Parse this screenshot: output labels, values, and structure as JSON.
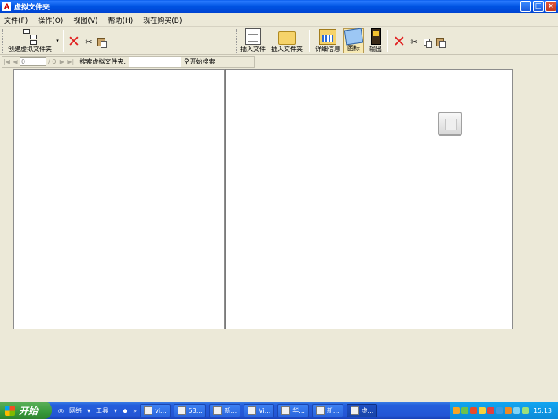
{
  "window": {
    "title": "虚拟文件夹",
    "min": "_",
    "max": "□",
    "close": "×"
  },
  "menu": [
    "文件(F)",
    "操作(O)",
    "视图(V)",
    "帮助(H)",
    "现在购买(B)"
  ],
  "toolbar": {
    "create_folder": "创建虚拟文件夹",
    "insert_file": "插入文件",
    "insert_folder": "插入文件夹",
    "details": "详细信息",
    "large_icons": "图标",
    "export": "输出"
  },
  "searchbar": {
    "page_value": "0",
    "page_total": "/ 0",
    "label": "搜索虚拟文件夹:",
    "query": "",
    "button": "开始搜索"
  },
  "taskbar": {
    "start": "开始",
    "quick_launch": [
      "网络",
      "工具"
    ],
    "tasks": [
      "vi...",
      "53...",
      "新...",
      "Vi...",
      "华...",
      "新...",
      "虚..."
    ],
    "clock": "15:13"
  },
  "colors": {
    "titlebar": "#0054E3",
    "taskbar": "#245EDC",
    "start": "#37993A",
    "tray": "#0B8AD8"
  }
}
